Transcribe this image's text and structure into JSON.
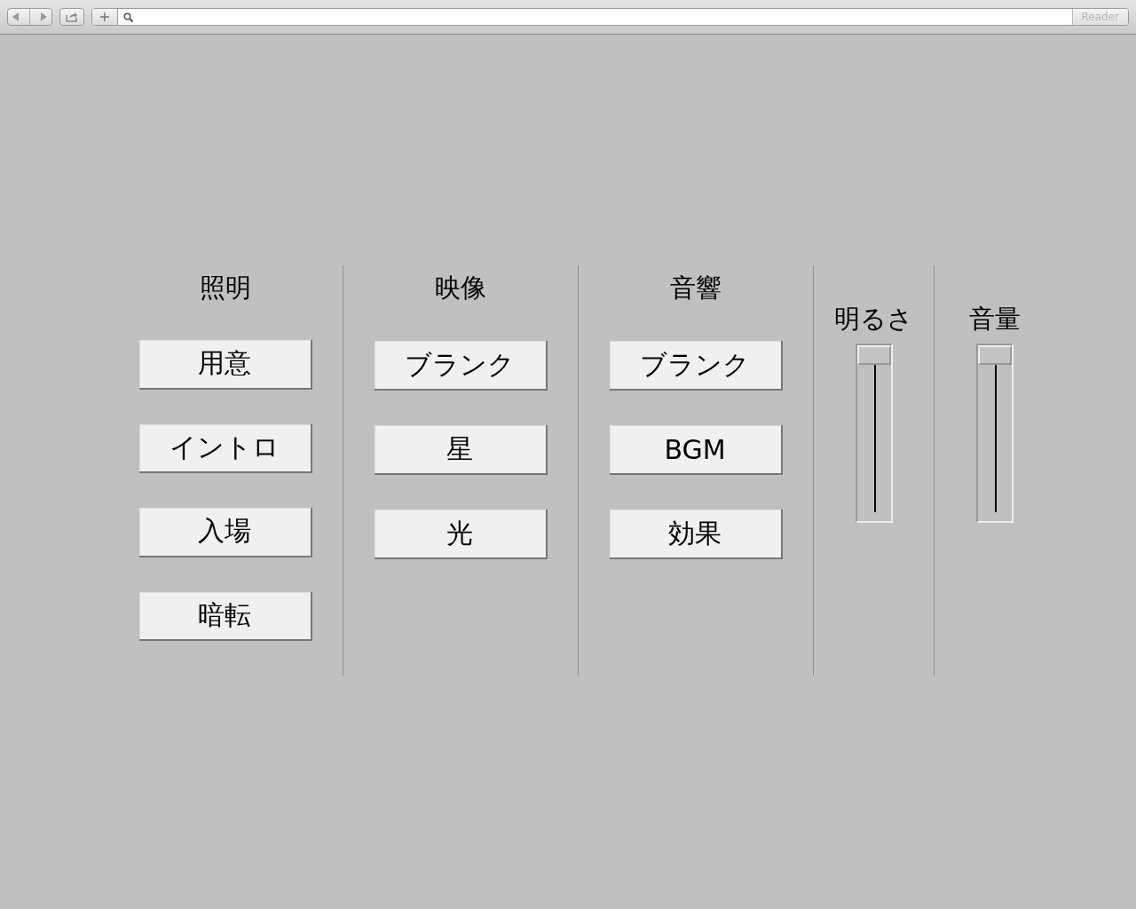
{
  "toolbar": {
    "reader_label": "Reader"
  },
  "sections": [
    {
      "title": "照明",
      "buttons": [
        "用意",
        "イントロ",
        "入場",
        "暗転"
      ]
    },
    {
      "title": "映像",
      "buttons": [
        "ブランク",
        "星",
        "光"
      ]
    },
    {
      "title": "音響",
      "buttons": [
        "ブランク",
        "BGM",
        "効果"
      ]
    }
  ],
  "sliders": [
    {
      "label": "明るさ",
      "level": 1
    },
    {
      "label": "音量",
      "level": 1
    }
  ]
}
